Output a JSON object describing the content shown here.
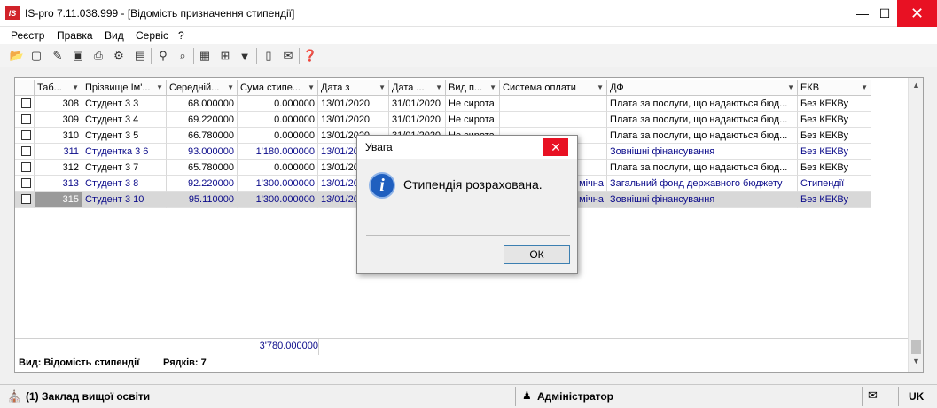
{
  "window": {
    "title": "IS-pro 7.11.038.999 - [Відомість призначення стипендії]",
    "icon_text": "IS"
  },
  "menu": [
    "Реєстр",
    "Правка",
    "Вид",
    "Сервіс",
    "?"
  ],
  "table": {
    "columns": [
      "Таб...",
      "Прізвище Ім'...",
      "Середній...",
      "Сума стипе...",
      "Дата з",
      "Дата ...",
      "Вид п...",
      "Система оплати",
      "ДФ",
      "ЕКВ"
    ],
    "rows": [
      {
        "tab": "308",
        "name": "Студент 3 3",
        "avg": "68.000000",
        "sum": "0.000000",
        "date_from": "13/01/2020",
        "date_to": "31/01/2020",
        "kind": "Не сирота",
        "pay": "",
        "df": "Плата за послуги, що надаються бюд...",
        "ekv": "Без КЕКВу",
        "style": "normal"
      },
      {
        "tab": "309",
        "name": "Студент 3 4",
        "avg": "69.220000",
        "sum": "0.000000",
        "date_from": "13/01/2020",
        "date_to": "31/01/2020",
        "kind": "Не сирота",
        "pay": "",
        "df": "Плата за послуги, що надаються бюд...",
        "ekv": "Без КЕКВу",
        "style": "normal"
      },
      {
        "tab": "310",
        "name": "Студент 3 5",
        "avg": "66.780000",
        "sum": "0.000000",
        "date_from": "13/01/2020",
        "date_to": "31/01/2020",
        "kind": "Не сирота",
        "pay": "",
        "df": "Плата за послуги, що надаються бюд...",
        "ekv": "Без КЕКВу",
        "style": "normal"
      },
      {
        "tab": "311",
        "name": "Студентка 3 6",
        "avg": "93.000000",
        "sum": "1'180.000000",
        "date_from": "13/01/2020",
        "date_to": "",
        "kind": "",
        "pay": "",
        "df": "Зовнішні фінансування",
        "ekv": "Без КЕКВу",
        "style": "blue"
      },
      {
        "tab": "312",
        "name": "Студент 3 7",
        "avg": "65.780000",
        "sum": "0.000000",
        "date_from": "13/01/2020",
        "date_to": "",
        "kind": "",
        "pay": "",
        "df": "Плата за послуги, що надаються бюд...",
        "ekv": "Без КЕКВу",
        "style": "normal"
      },
      {
        "tab": "313",
        "name": "Студент 3 8",
        "avg": "92.220000",
        "sum": "1'300.000000",
        "date_from": "13/01/2020",
        "date_to": "",
        "kind": "",
        "pay": "мічна",
        "df": "Загальний фонд державного бюджету",
        "ekv": "Стипендії",
        "style": "blue"
      },
      {
        "tab": "315",
        "name": "Студент 3 10",
        "avg": "95.110000",
        "sum": "1'300.000000",
        "date_from": "13/01/2020",
        "date_to": "",
        "kind": "",
        "pay": "мічна",
        "df": "Зовнішні фінансування",
        "ekv": "Без КЕКВу",
        "style": "selected"
      }
    ],
    "total_sum": "3'780.000000"
  },
  "status": {
    "view_text": "Вид: Відомість стипендії",
    "rows_text": "Рядків: 7"
  },
  "dialog": {
    "title": "Увага",
    "message": "Стипендія розрахована.",
    "ok_label": "ОК"
  },
  "statusbar": {
    "org": "(1) Заклад вищої освіти",
    "user": "Адміністратор",
    "lang": "UK"
  }
}
